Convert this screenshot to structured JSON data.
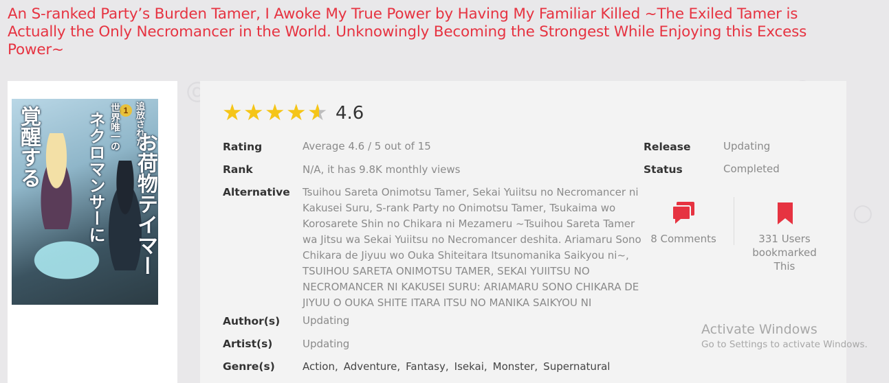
{
  "title": "An S-ranked Party’s Burden Tamer, I Awoke My True Power by Having My Familiar Killed ~The Exiled Tamer is Actually the Only Necromancer in the World. Unknowingly Becoming the Strongest While Enjoying this Excess Power~",
  "cover": {
    "kanji_1": "追放された",
    "kanji_2": "世界唯一の",
    "kanji_3": "お荷物テイマー",
    "kanji_4": "ネクロマンサーに",
    "kanji_5": "覚醒する",
    "volume": "1"
  },
  "rating": {
    "stars": 4.6,
    "score": "4.6"
  },
  "details": {
    "rating_label": "Rating",
    "rating_value": "Average 4.6 / 5 out of 15",
    "rank_label": "Rank",
    "rank_value": "N/A, it has 9.8K monthly views",
    "alternative_label": "Alternative",
    "alternative_value": "Tsuihou Sareta Onimotsu Tamer, Sekai Yuiitsu no Necromancer ni Kakusei Suru, S-rank Party no Onimotsu Tamer, Tsukaima wo Korosarete Shin no Chikara ni Mezameru ~Tsuihou Sareta Tamer wa Jitsu wa Sekai Yuiitsu no Necromancer deshita. Ariamaru Sono Chikara de Jiyuu wo Ouka Shiteitara Itsunomanika Saikyou ni~, TSUIHOU SARETA ONIMOTSU TAMER, SEKAI YUIITSU NO NECROMANCER NI KAKUSEI SURU: ARIAMARU SONO CHIKARA DE JIYUU O OUKA SHITE ITARA ITSU NO MANIKA SAIKYOU NI",
    "author_label": "Author(s)",
    "author_value": "Updating",
    "artist_label": "Artist(s)",
    "artist_value": "Updating",
    "genre_label": "Genre(s)",
    "genres": [
      "Action",
      "Adventure",
      "Fantasy",
      "Isekai",
      "Monster",
      "Supernatural"
    ],
    "release_label": "Release",
    "release_value": "Updating",
    "status_label": "Status",
    "status_value": "Completed"
  },
  "stats": {
    "comments": "8 Comments",
    "bookmarks_line1": "331 Users",
    "bookmarks_line2": "bookmarked",
    "bookmarks_line3": "This"
  },
  "watermark": {
    "line1": "Activate Windows",
    "line2": "Go to Settings to activate Windows."
  },
  "colors": {
    "accent": "#e63341",
    "star": "#f5c518",
    "background": "#e9e8ea"
  }
}
